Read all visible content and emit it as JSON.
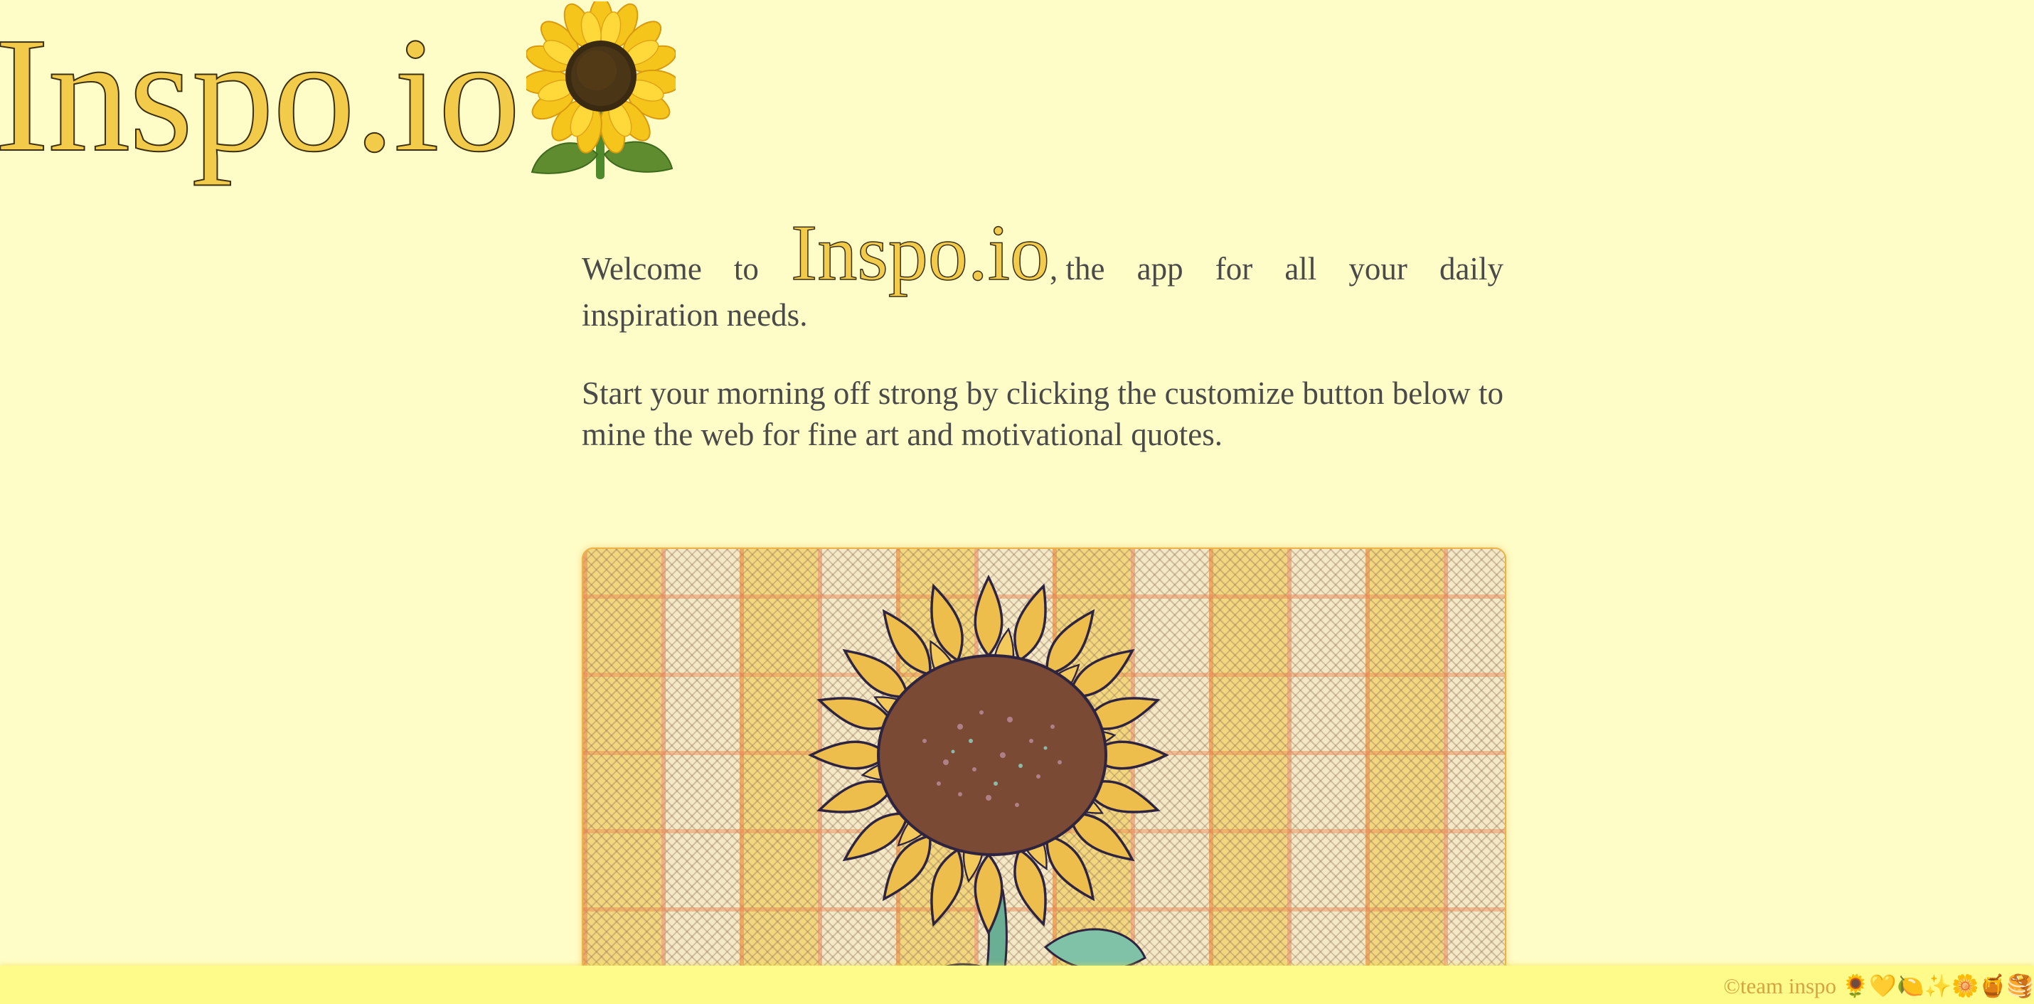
{
  "header": {
    "logo_text": "Inspo.io",
    "logo_emoji_icon": "sunflower-icon"
  },
  "intro": {
    "welcome_prefix_1": "Welcome",
    "welcome_prefix_2": "to",
    "brand": "Inspo.io",
    "welcome_suffix_1": ", the",
    "welcome_suffix_2": "app",
    "welcome_suffix_3": "for",
    "welcome_suffix_4": "all",
    "welcome_suffix_5": "your",
    "welcome_suffix_6": "daily",
    "welcome_line2": "inspiration needs.",
    "paragraph2": "Start your morning off strong by clicking the customize button below to mine the web for fine art and motivational quotes."
  },
  "art": {
    "image_subject": "sunflower-artwork"
  },
  "footer": {
    "credit": "©team inspo 🌻💛🍋✨🌼🍯🥞"
  },
  "colors": {
    "background": "#FFFDC7",
    "brand_yellow": "#F3CB4A",
    "footer_bg": "#FFFB8A",
    "footer_text": "#D5A440",
    "body_text": "#4a4a4a"
  }
}
